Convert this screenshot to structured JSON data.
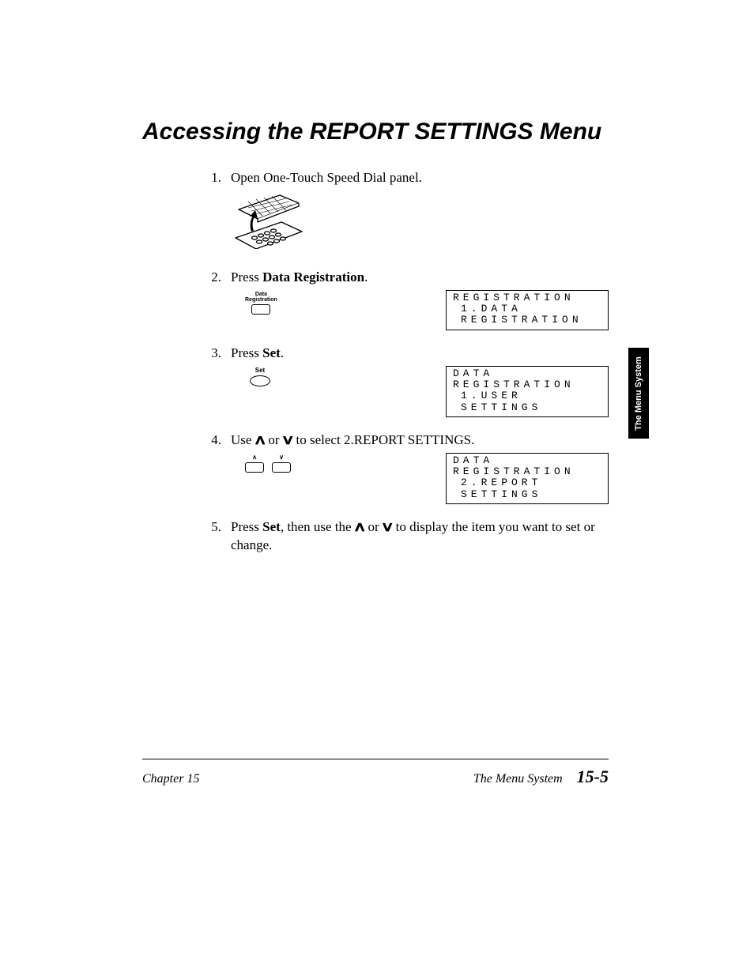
{
  "title": "Accessing the REPORT SETTINGS Menu",
  "side_tab": "The Menu System",
  "steps": [
    {
      "num": "1.",
      "text": "Open One-Touch Speed Dial panel."
    },
    {
      "num": "2.",
      "prefix": "Press ",
      "bold": "Data Registration",
      "suffix": ".",
      "key_label": "Data\nRegistration",
      "lcd1": "REGISTRATION",
      "lcd2": "1.DATA REGISTRATION"
    },
    {
      "num": "3.",
      "prefix": "Press ",
      "bold": "Set",
      "suffix": ".",
      "key_label": "Set",
      "lcd1": "DATA REGISTRATION",
      "lcd2": "1.USER SETTINGS"
    },
    {
      "num": "4.",
      "seg1": "Use ",
      "caret1": "∧",
      "seg2": " or ",
      "caret2": "∨",
      "seg3": " to select 2.REPORT SETTINGS.",
      "arrow_up": "∧",
      "arrow_down": "∨",
      "lcd1": "DATA REGISTRATION",
      "lcd2": "2.REPORT SETTINGS"
    },
    {
      "num": "5.",
      "seg1": "Press ",
      "bold": "Set",
      "seg2": ", then use the ",
      "caret1": "∧",
      "seg3": " or ",
      "caret2": "∨",
      "seg4": " to display the item you want to set or change."
    }
  ],
  "footer": {
    "left": "Chapter 15",
    "right_label": "The Menu System",
    "page": "15-5"
  }
}
